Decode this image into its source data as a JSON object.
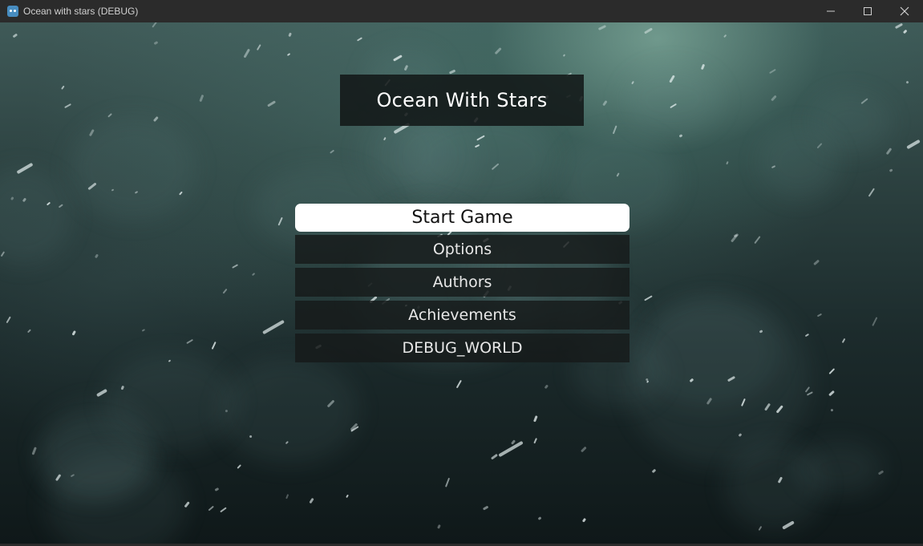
{
  "window": {
    "title": "Ocean with stars (DEBUG)",
    "controls": [
      {
        "name": "minimize",
        "icon": "minimize-icon"
      },
      {
        "name": "maximize",
        "icon": "maximize-icon"
      },
      {
        "name": "close",
        "icon": "close-icon"
      }
    ]
  },
  "game": {
    "title": "Ocean With Stars",
    "menu": {
      "items": [
        {
          "label": "Start Game",
          "selected": true
        },
        {
          "label": "Options",
          "selected": false
        },
        {
          "label": "Authors",
          "selected": false
        },
        {
          "label": "Achievements",
          "selected": false
        },
        {
          "label": "DEBUG_WORLD",
          "selected": false
        }
      ]
    }
  },
  "colors": {
    "titlebar": "#2b2b2b",
    "selected_button": "#ffffff",
    "menu_button": "#161a1a"
  }
}
